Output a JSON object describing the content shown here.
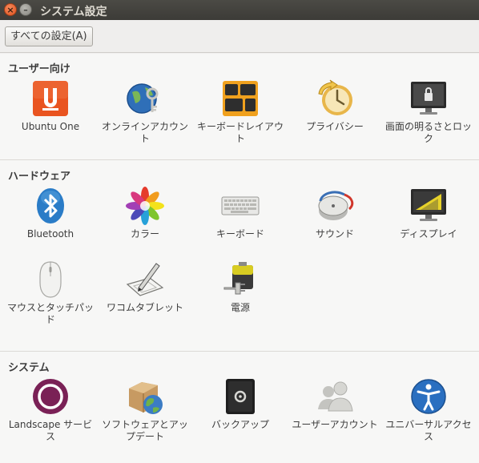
{
  "window": {
    "title": "システム設定",
    "close_glyph": "×",
    "minimize_glyph": "–"
  },
  "toolbar": {
    "all_settings_label": "すべての設定(A)"
  },
  "sections": [
    {
      "title": "ユーザー向け",
      "items": [
        {
          "label": "Ubuntu One",
          "icon": "ubuntu-one-icon"
        },
        {
          "label": "オンラインアカウント",
          "icon": "online-accounts-icon"
        },
        {
          "label": "キーボードレイアウト",
          "icon": "keyboard-layout-icon"
        },
        {
          "label": "プライバシー",
          "icon": "privacy-icon"
        },
        {
          "label": "画面の明るさとロック",
          "icon": "brightness-lock-icon"
        }
      ]
    },
    {
      "title": "ハードウェア",
      "items": [
        {
          "label": "Bluetooth",
          "icon": "bluetooth-icon"
        },
        {
          "label": "カラー",
          "icon": "color-icon"
        },
        {
          "label": "キーボード",
          "icon": "keyboard-icon"
        },
        {
          "label": "サウンド",
          "icon": "sound-icon"
        },
        {
          "label": "ディスプレイ",
          "icon": "display-icon"
        },
        {
          "label": "マウスとタッチパッド",
          "icon": "mouse-icon"
        },
        {
          "label": "ワコムタブレット",
          "icon": "wacom-tablet-icon"
        },
        {
          "label": "電源",
          "icon": "power-icon"
        }
      ]
    },
    {
      "title": "システム",
      "items": [
        {
          "label": "Landscape サービス",
          "icon": "landscape-icon"
        },
        {
          "label": "ソフトウェアとアップデート",
          "icon": "software-updates-icon"
        },
        {
          "label": "バックアップ",
          "icon": "backup-icon"
        },
        {
          "label": "ユーザーアカウント",
          "icon": "user-accounts-icon"
        },
        {
          "label": "ユニバーサルアクセス",
          "icon": "universal-access-icon"
        }
      ]
    }
  ],
  "colors": {
    "titlebar": "#3c3b37",
    "close_button": "#e0521f",
    "ubuntu_orange": "#e95420"
  }
}
